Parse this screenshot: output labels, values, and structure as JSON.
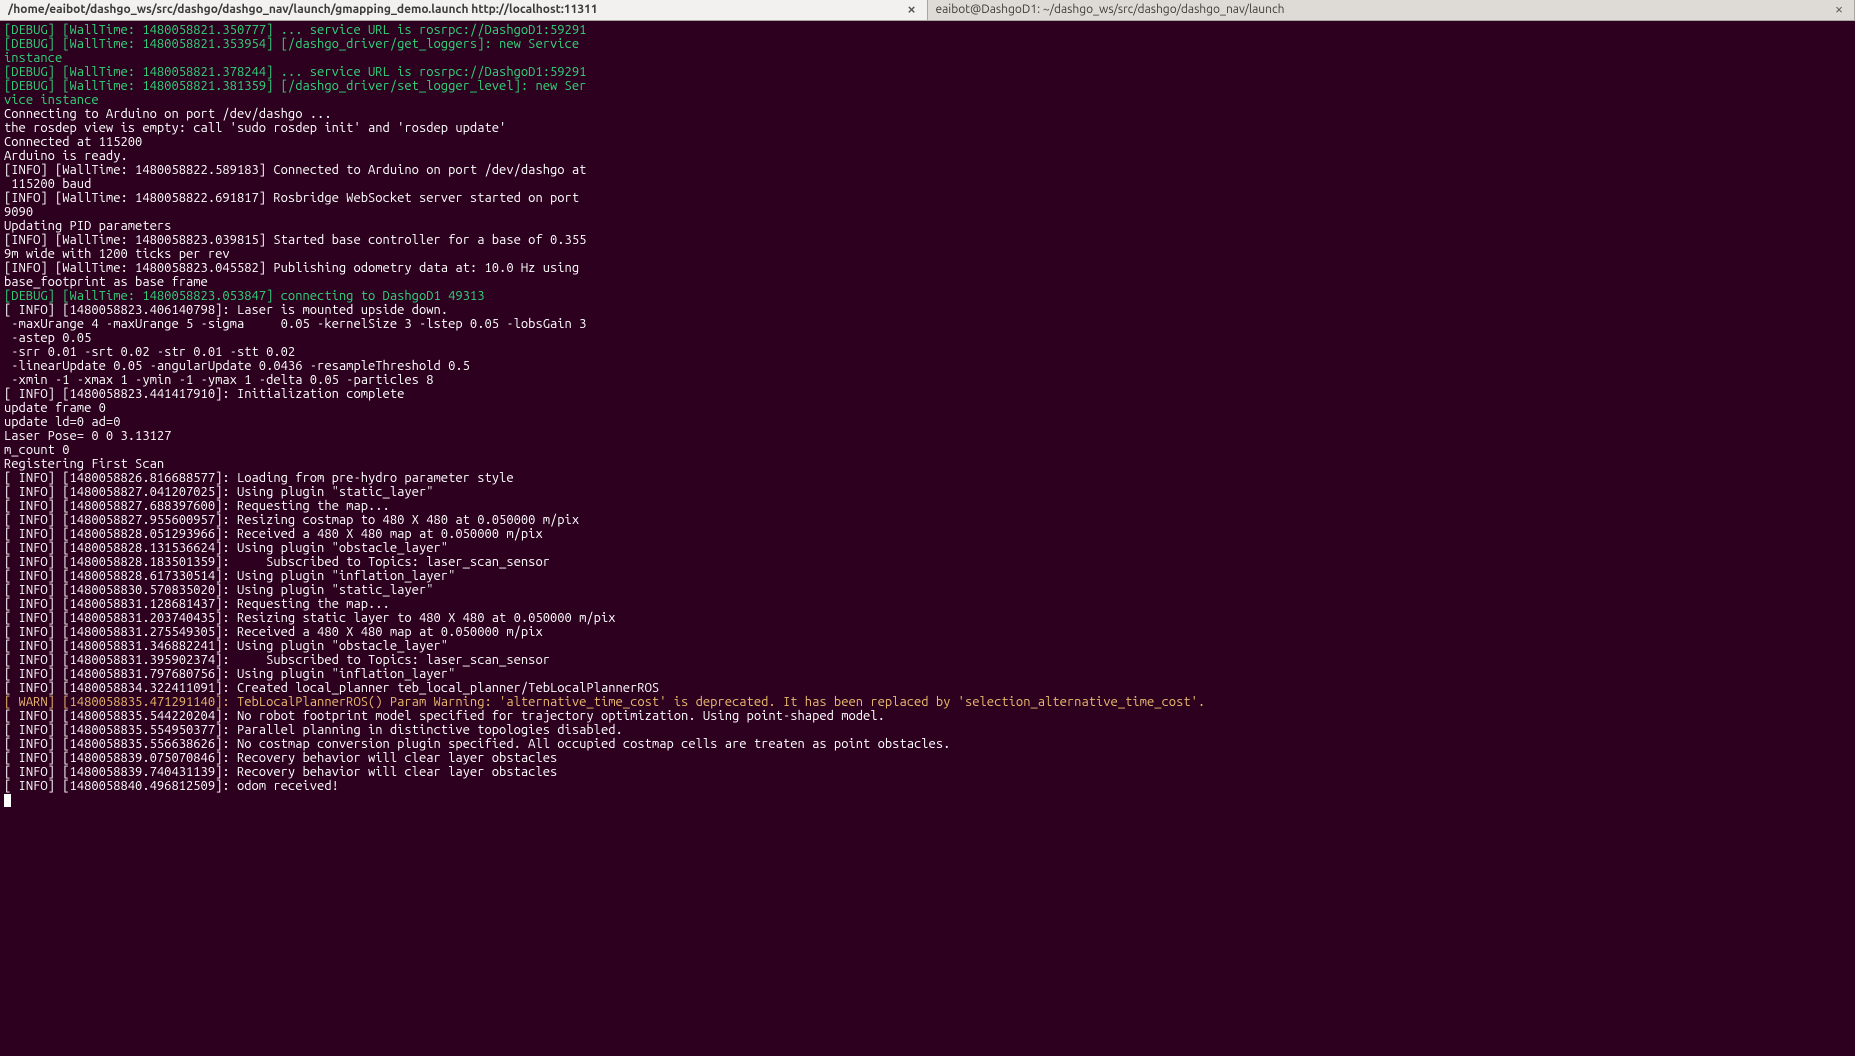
{
  "tabs": [
    {
      "title": "/home/eaibot/dashgo_ws/src/dashgo/dashgo_nav/launch/gmapping_demo.launch http://localhost:11311",
      "active": true
    },
    {
      "title": "eaibot@DashgoD1: ~/dashgo_ws/src/dashgo/dashgo_nav/launch",
      "active": false
    }
  ],
  "log": [
    {
      "cls": "debug",
      "text": "[DEBUG] [WallTime: 1480058821.350777] ... service URL is rosrpc://DashgoD1:59291"
    },
    {
      "cls": "debug",
      "text": "[DEBUG] [WallTime: 1480058821.353954] [/dashgo_driver/get_loggers]: new Service"
    },
    {
      "cls": "debug",
      "text": "instance"
    },
    {
      "cls": "debug",
      "text": "[DEBUG] [WallTime: 1480058821.378244] ... service URL is rosrpc://DashgoD1:59291"
    },
    {
      "cls": "debug",
      "text": "[DEBUG] [WallTime: 1480058821.381359] [/dashgo_driver/set_logger_level]: new Ser"
    },
    {
      "cls": "debug",
      "text": "vice instance"
    },
    {
      "cls": "",
      "text": "Connecting to Arduino on port /dev/dashgo ..."
    },
    {
      "cls": "",
      "text": "the rosdep view is empty: call 'sudo rosdep init' and 'rosdep update'"
    },
    {
      "cls": "",
      "text": "Connected at 115200"
    },
    {
      "cls": "",
      "text": "Arduino is ready."
    },
    {
      "cls": "",
      "text": "[INFO] [WallTime: 1480058822.589183] Connected to Arduino on port /dev/dashgo at"
    },
    {
      "cls": "",
      "text": " 115200 baud"
    },
    {
      "cls": "",
      "text": "[INFO] [WallTime: 1480058822.691817] Rosbridge WebSocket server started on port "
    },
    {
      "cls": "",
      "text": "9090"
    },
    {
      "cls": "",
      "text": "Updating PID parameters"
    },
    {
      "cls": "",
      "text": "[INFO] [WallTime: 1480058823.039815] Started base controller for a base of 0.355"
    },
    {
      "cls": "",
      "text": "9m wide with 1200 ticks per rev"
    },
    {
      "cls": "",
      "text": "[INFO] [WallTime: 1480058823.045582] Publishing odometry data at: 10.0 Hz using "
    },
    {
      "cls": "",
      "text": "base_footprint as base frame"
    },
    {
      "cls": "debug",
      "text": "[DEBUG] [WallTime: 1480058823.053847] connecting to DashgoD1 49313"
    },
    {
      "cls": "",
      "text": "[ INFO] [1480058823.406140798]: Laser is mounted upside down."
    },
    {
      "cls": "",
      "text": " -maxUrange 4 -maxUrange 5 -sigma     0.05 -kernelSize 3 -lstep 0.05 -lobsGain 3"
    },
    {
      "cls": "",
      "text": " -astep 0.05"
    },
    {
      "cls": "",
      "text": " -srr 0.01 -srt 0.02 -str 0.01 -stt 0.02"
    },
    {
      "cls": "",
      "text": " -linearUpdate 0.05 -angularUpdate 0.0436 -resampleThreshold 0.5"
    },
    {
      "cls": "",
      "text": " -xmin -1 -xmax 1 -ymin -1 -ymax 1 -delta 0.05 -particles 8"
    },
    {
      "cls": "",
      "text": "[ INFO] [1480058823.441417910]: Initialization complete"
    },
    {
      "cls": "",
      "text": "update frame 0"
    },
    {
      "cls": "",
      "text": "update ld=0 ad=0"
    },
    {
      "cls": "",
      "text": "Laser Pose= 0 0 3.13127"
    },
    {
      "cls": "",
      "text": "m_count 0"
    },
    {
      "cls": "",
      "text": "Registering First Scan"
    },
    {
      "cls": "",
      "text": "[ INFO] [1480058826.816688577]: Loading from pre-hydro parameter style"
    },
    {
      "cls": "",
      "text": "[ INFO] [1480058827.041207025]: Using plugin \"static_layer\""
    },
    {
      "cls": "",
      "text": "[ INFO] [1480058827.688397600]: Requesting the map..."
    },
    {
      "cls": "",
      "text": "[ INFO] [1480058827.955600957]: Resizing costmap to 480 X 480 at 0.050000 m/pix"
    },
    {
      "cls": "",
      "text": "[ INFO] [1480058828.051293966]: Received a 480 X 480 map at 0.050000 m/pix"
    },
    {
      "cls": "",
      "text": "[ INFO] [1480058828.131536624]: Using plugin \"obstacle_layer\""
    },
    {
      "cls": "",
      "text": "[ INFO] [1480058828.183501359]:     Subscribed to Topics: laser_scan_sensor"
    },
    {
      "cls": "",
      "text": "[ INFO] [1480058828.617330514]: Using plugin \"inflation_layer\""
    },
    {
      "cls": "",
      "text": "[ INFO] [1480058830.570835020]: Using plugin \"static_layer\""
    },
    {
      "cls": "",
      "text": "[ INFO] [1480058831.128681437]: Requesting the map..."
    },
    {
      "cls": "",
      "text": "[ INFO] [1480058831.203740435]: Resizing static layer to 480 X 480 at 0.050000 m/pix"
    },
    {
      "cls": "",
      "text": "[ INFO] [1480058831.275549305]: Received a 480 X 480 map at 0.050000 m/pix"
    },
    {
      "cls": "",
      "text": "[ INFO] [1480058831.346882241]: Using plugin \"obstacle_layer\""
    },
    {
      "cls": "",
      "text": "[ INFO] [1480058831.395902374]:     Subscribed to Topics: laser_scan_sensor"
    },
    {
      "cls": "",
      "text": "[ INFO] [1480058831.797680756]: Using plugin \"inflation_layer\""
    },
    {
      "cls": "",
      "text": "[ INFO] [1480058834.322411091]: Created local_planner teb_local_planner/TebLocalPlannerROS"
    },
    {
      "cls": "warn",
      "text": "[ WARN] [1480058835.471291140]: TebLocalPlannerROS() Param Warning: 'alternative_time_cost' is deprecated. It has been replaced by 'selection_alternative_time_cost'."
    },
    {
      "cls": "",
      "text": "[ INFO] [1480058835.544220204]: No robot footprint model specified for trajectory optimization. Using point-shaped model."
    },
    {
      "cls": "",
      "text": "[ INFO] [1480058835.554950377]: Parallel planning in distinctive topologies disabled."
    },
    {
      "cls": "",
      "text": "[ INFO] [1480058835.556638626]: No costmap conversion plugin specified. All occupied costmap cells are treaten as point obstacles."
    },
    {
      "cls": "",
      "text": "[ INFO] [1480058839.075070846]: Recovery behavior will clear layer obstacles"
    },
    {
      "cls": "",
      "text": "[ INFO] [1480058839.740431139]: Recovery behavior will clear layer obstacles"
    },
    {
      "cls": "",
      "text": "[ INFO] [1480058840.496812509]: odom received!"
    }
  ]
}
